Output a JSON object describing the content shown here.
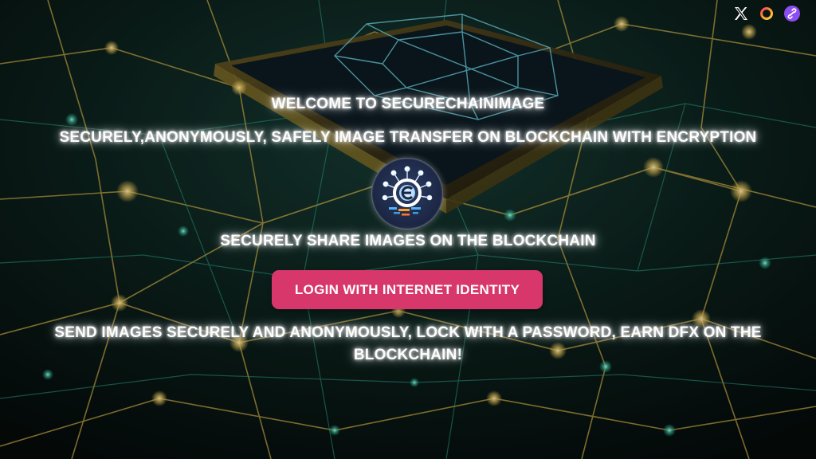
{
  "header": {
    "social": [
      {
        "icon": "x-logo-icon",
        "name": "x-link"
      },
      {
        "icon": "ring-logo-icon",
        "name": "ring-link"
      },
      {
        "icon": "link-chain-icon",
        "name": "chain-link"
      }
    ]
  },
  "main": {
    "welcome": "WELCOME TO SECURECHAINIMAGE",
    "subtitle": "SECURELY,ANONYMOUSLY, SAFELY IMAGE TRANSFER ON BLOCKCHAIN WITH ENCRYPTION",
    "logo_icon": "securechainimage-logo-icon",
    "share_heading": "SECURELY SHARE IMAGES ON THE BLOCKCHAIN",
    "login_label": "LOGIN WITH INTERNET IDENTITY",
    "cta_text": "SEND IMAGES SECURELY AND ANONYMOUSLY, LOCK WITH A PASSWORD, EARN DFX ON THE BLOCKCHAIN!"
  },
  "colors": {
    "accent": "#d8376b",
    "background": "#06120f",
    "network_glow": "#e8c25a",
    "network_teal": "#35c4a6",
    "text": "#ffffff"
  }
}
